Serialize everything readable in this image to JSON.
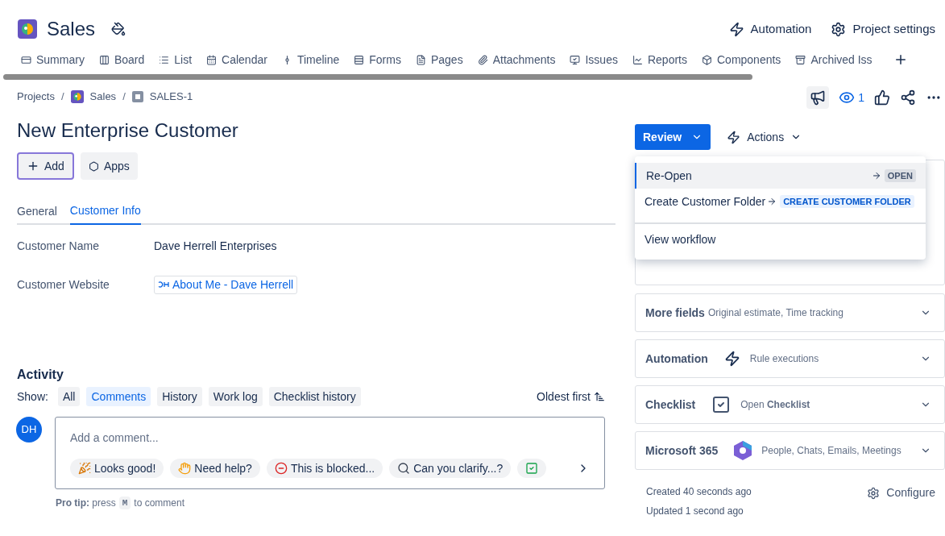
{
  "project": {
    "name": "Sales"
  },
  "header_actions": [
    {
      "kind": "automation",
      "label": "Automation"
    },
    {
      "kind": "settings",
      "label": "Project settings"
    }
  ],
  "nav_tabs": [
    {
      "kind": "summary",
      "label": "Summary"
    },
    {
      "kind": "board",
      "label": "Board"
    },
    {
      "kind": "list",
      "label": "List"
    },
    {
      "kind": "calendar",
      "label": "Calendar"
    },
    {
      "kind": "timeline",
      "label": "Timeline"
    },
    {
      "kind": "forms",
      "label": "Forms"
    },
    {
      "kind": "pages",
      "label": "Pages"
    },
    {
      "kind": "attachments",
      "label": "Attachments"
    },
    {
      "kind": "issues",
      "label": "Issues"
    },
    {
      "kind": "reports",
      "label": "Reports"
    },
    {
      "kind": "components",
      "label": "Components"
    },
    {
      "kind": "archived",
      "label": "Archived Iss"
    }
  ],
  "breadcrumb_separator": "/",
  "breadcrumbs": [
    {
      "kind": "text",
      "label": "Projects"
    },
    {
      "kind": "project",
      "label": "Sales"
    },
    {
      "kind": "issue",
      "label": "SALES-1"
    }
  ],
  "watchers": "1",
  "issue": {
    "title": "New Enterprise Customer",
    "buttons": [
      {
        "kind": "add",
        "label": "Add",
        "selected": true
      },
      {
        "kind": "apps",
        "label": "Apps",
        "selected": false
      }
    ]
  },
  "tabs": [
    {
      "label": "General",
      "selected": false
    },
    {
      "label": "Customer Info",
      "selected": true
    }
  ],
  "fields": [
    {
      "kind": "text",
      "label": "Customer Name",
      "value": "Dave Herrell Enterprises"
    },
    {
      "kind": "link",
      "label": "Customer Website",
      "value": "About Me - Dave Herrell"
    }
  ],
  "activity": {
    "title": "Activity",
    "show_label": "Show:",
    "filters": [
      {
        "label": "All",
        "selected": false
      },
      {
        "label": "Comments",
        "selected": true
      },
      {
        "label": "History",
        "selected": false
      },
      {
        "label": "Work log",
        "selected": false
      },
      {
        "label": "Checklist history",
        "selected": false
      }
    ],
    "sort": "Oldest first",
    "avatar": "DH",
    "placeholder": "Add a comment...",
    "quick_replies": [
      {
        "kind": "party",
        "label": "Looks good!"
      },
      {
        "kind": "wave",
        "label": "Need help?"
      },
      {
        "kind": "blocked",
        "label": "This is blocked..."
      },
      {
        "kind": "search",
        "label": "Can you clarify...?"
      },
      {
        "kind": "check"
      }
    ],
    "tip": "**Pro tip:** press",
    "tip_key": "M",
    "tip_end": "to comment"
  },
  "status_button": "Review",
  "actions_button": "Actions",
  "dropdown": {
    "transitions": [
      {
        "label": "Re-Open",
        "target": "OPEN",
        "kind": "gray",
        "selected": true
      },
      {
        "label": "Create Customer Folder",
        "target": "CREATE CUSTOMER FOLDER",
        "kind": "blue",
        "selected": false
      }
    ],
    "footer": "View workflow"
  },
  "panels": [
    {
      "kind": "text",
      "title": "More fields",
      "subtitle": "Original estimate, Time tracking"
    },
    {
      "kind": "automation",
      "title": "Automation",
      "subtitle": "Rule executions"
    },
    {
      "kind": "checklist",
      "title": "Checklist",
      "subtitle": "Open **Checklist**"
    },
    {
      "kind": "microsoft",
      "title": "Microsoft 365",
      "subtitle": "People, Chats, Emails, Meetings"
    }
  ],
  "created": "Created 40 seconds ago",
  "updated": "Updated 1 second ago",
  "configure": "Configure"
}
